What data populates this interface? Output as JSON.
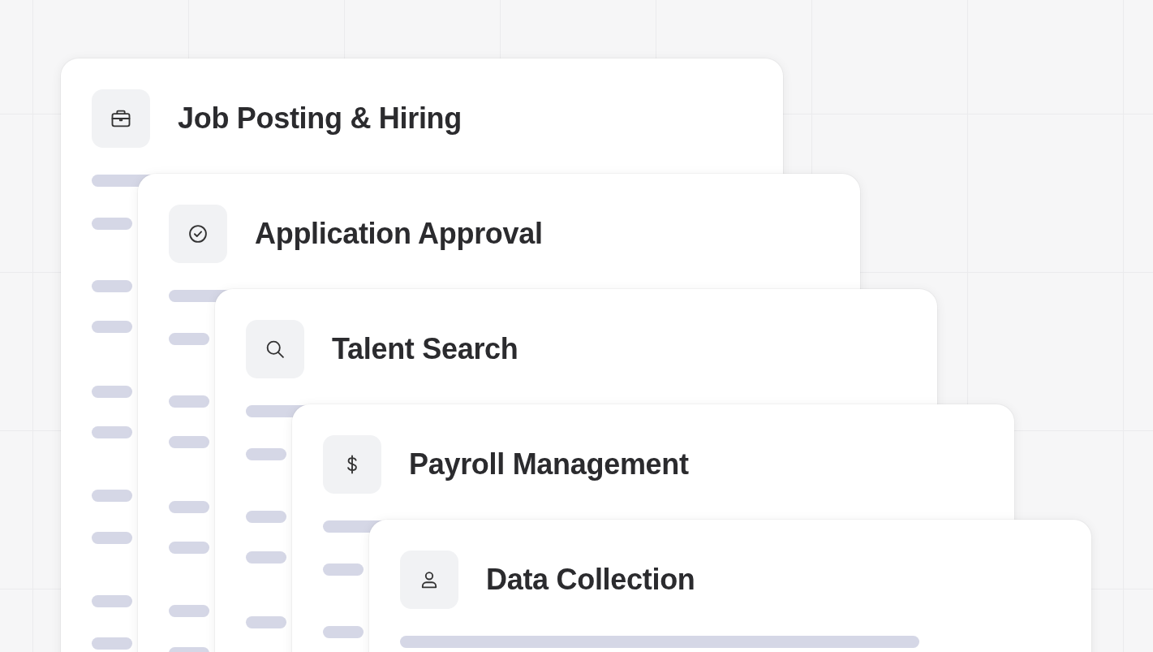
{
  "cards": [
    {
      "kind": "briefcase",
      "title": "Job Posting & Hiring"
    },
    {
      "kind": "check",
      "title": "Application Approval"
    },
    {
      "kind": "search",
      "title": "Talent Search"
    },
    {
      "kind": "dollar",
      "title": "Payroll Management"
    },
    {
      "kind": "person",
      "title": "Data Collection"
    }
  ]
}
